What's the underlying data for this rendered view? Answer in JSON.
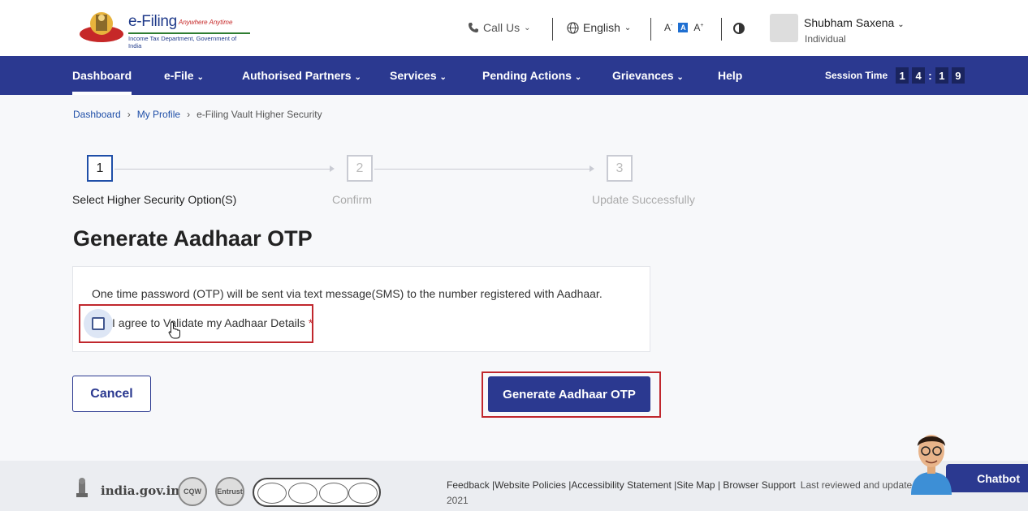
{
  "header": {
    "logo_title": "e-Filing",
    "logo_tagline": "Anywhere Anytime",
    "logo_sub": "Income Tax Department, Government of India",
    "call_us": "Call Us",
    "language": "English",
    "font_small": "A",
    "font_mid": "A",
    "font_large": "A",
    "user_name": "Shubham Saxena",
    "user_role": "Individual"
  },
  "nav": {
    "items": [
      {
        "label": "Dashboard"
      },
      {
        "label": "e-File"
      },
      {
        "label": "Authorised Partners"
      },
      {
        "label": "Services"
      },
      {
        "label": "Pending Actions"
      },
      {
        "label": "Grievances"
      },
      {
        "label": "Help"
      }
    ],
    "session_label": "Session Time",
    "session_digits": [
      "1",
      "4",
      ":",
      "1",
      "9"
    ]
  },
  "breadcrumb": {
    "items": [
      "Dashboard",
      "My Profile",
      "e-Filing Vault Higher Security"
    ]
  },
  "stepper": {
    "steps": [
      {
        "num": "1",
        "label": "Select Higher Security Option(S)"
      },
      {
        "num": "2",
        "label": "Confirm"
      },
      {
        "num": "3",
        "label": "Update Successfully"
      }
    ]
  },
  "main": {
    "title": "Generate Aadhaar OTP",
    "info_text": "One time password (OTP) will be sent via text message(SMS) to the number registered with Aadhaar.",
    "agree_label": "I agree to Validate my Aadhaar Details",
    "required_mark": "*",
    "cancel_label": "Cancel",
    "generate_label": "Generate Aadhaar OTP"
  },
  "footer": {
    "india_gov": "india.gov.in",
    "badge_cqw": "CQW",
    "badge_entrust": "Entrust",
    "links": "Feedback |Website Policies |Accessibility Statement |Site Map | Browser Support",
    "last_reviewed": "Last reviewed and update on :",
    "year_fragment": "2021"
  },
  "chatbot": {
    "label": "Chatbot"
  },
  "colors": {
    "primary": "#2b3990",
    "highlight": "#c0272d",
    "link": "#1f4fa8"
  }
}
